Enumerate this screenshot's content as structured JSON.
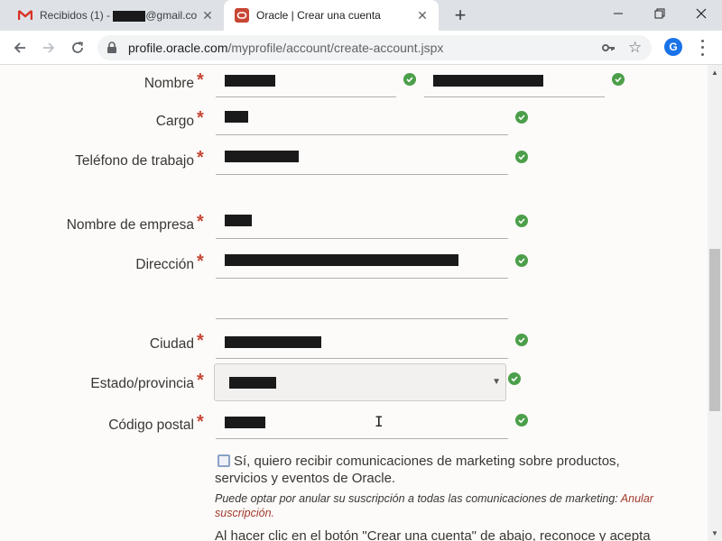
{
  "browser": {
    "tabs": [
      {
        "title_prefix": "Recibidos (1) - ",
        "title_suffix": "@gmail.co",
        "icon": "gmail-icon",
        "active": false
      },
      {
        "title": "Oracle | Crear una cuenta",
        "icon": "oracle-icon",
        "active": true
      }
    ],
    "new_tab_label": "+",
    "url_host": "profile.oracle.com",
    "url_path": "/myprofile/account/create-account.jspx",
    "profile_initial": "G",
    "accent_color": "#1a73e8"
  },
  "form": {
    "required_marker": "*",
    "fields": {
      "nombre": "Nombre",
      "cargo": "Cargo",
      "telefono": "Teléfono de trabajo",
      "empresa": "Nombre de empresa",
      "direccion": "Dirección",
      "ciudad": "Ciudad",
      "estado": "Estado/provincia",
      "codigo_postal": "Código postal"
    },
    "marketing_checkbox": "Sí, quiero recibir comunicaciones de marketing sobre productos, servicios y eventos de Oracle.",
    "unsubscribe_note": "Puede optar por anular su suscripción a todas las comunicaciones de marketing: ",
    "unsubscribe_link": "Anular suscripción.",
    "cut_text": "Al hacer clic en el botón \"Crear una cuenta\" de abajo, reconoce y acepta",
    "valid_color": "#4c9f4a",
    "required_color": "#c74634"
  }
}
